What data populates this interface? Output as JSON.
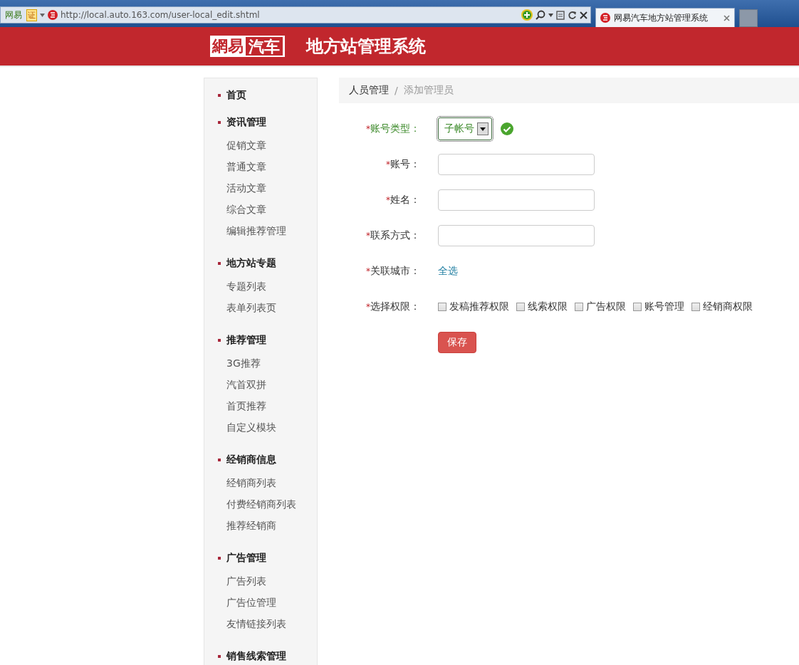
{
  "browser": {
    "badges": [
      "网易",
      "证"
    ],
    "url": "http://local.auto.163.com/user-local_edit.shtml",
    "tab_title": "网易汽车地方站管理系统"
  },
  "header": {
    "logo": [
      "網易",
      "汽车"
    ],
    "title": "地方站管理系统"
  },
  "sidebar": {
    "sections": [
      {
        "title": "首页"
      },
      {
        "title": "资讯管理",
        "items": [
          "促销文章",
          "普通文章",
          "活动文章",
          "综合文章",
          "编辑推荐管理"
        ]
      },
      {
        "title": "地方站专题",
        "items": [
          "专题列表",
          "表单列表页"
        ]
      },
      {
        "title": "推荐管理",
        "items": [
          "3G推荐",
          "汽首双拼",
          "首页推荐",
          "自定义模块"
        ]
      },
      {
        "title": "经销商信息",
        "items": [
          "经销商列表",
          "付费经销商列表",
          "推荐经销商"
        ]
      },
      {
        "title": "广告管理",
        "items": [
          "广告列表",
          "广告位管理",
          "友情链接列表"
        ]
      },
      {
        "title": "销售线索管理"
      }
    ]
  },
  "breadcrumb": {
    "items": [
      "人员管理",
      "添加管理员"
    ],
    "separator": "/"
  },
  "form": {
    "fields": [
      {
        "kind": "select",
        "required_mark": "*",
        "label": "账号类型：",
        "value": "子帐号",
        "valid": true
      },
      {
        "kind": "text",
        "required_mark": "*",
        "label": "账号："
      },
      {
        "kind": "text",
        "required_mark": "*",
        "label": "姓名："
      },
      {
        "kind": "text",
        "required_mark": "*",
        "label": "联系方式："
      },
      {
        "kind": "link",
        "required_mark": "*",
        "label": "关联城市：",
        "link": "全选"
      },
      {
        "kind": "checkboxes",
        "required_mark": "*",
        "label": "选择权限：",
        "options": [
          {
            "label": "发稿推荐权限",
            "checked": false
          },
          {
            "label": "线索权限",
            "checked": false
          },
          {
            "label": "广告权限",
            "checked": false
          },
          {
            "label": "账号管理",
            "checked": false
          },
          {
            "label": "经销商权限",
            "checked": false
          }
        ]
      }
    ],
    "save_button": "保存"
  }
}
